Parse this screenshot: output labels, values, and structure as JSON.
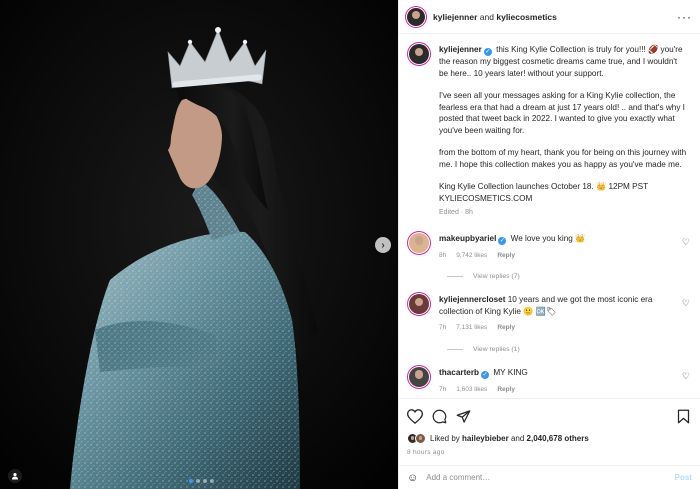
{
  "media": {
    "next_glyph": "›",
    "dots": [
      true,
      false,
      false,
      false
    ],
    "tag_icon": "user-tag-icon"
  },
  "header": {
    "user1": "kyliejenner",
    "and": "and",
    "user2": "kyliecosmetics",
    "more": "···"
  },
  "caption": {
    "username": "kyliejenner",
    "p1": "this King Kylie Collection is truly for you!!! 🏈 you're the reason my biggest cosmetic dreams came true, and I wouldn't be here.. 10 years later! without your support.",
    "p2": "I've seen all your messages asking for a King Kylie collection, the fearless era that had a dream at just 17 years old! .. and that's why I posted that tweet back in 2022. I wanted to give you exactly what you've been waiting for.",
    "p3": "from the bottom of my heart, thank you for being on this journey with me. I hope this collection makes you as happy as you've made me.",
    "p4a": "King Kylie Collection launches October 18. 👑 12PM PST",
    "p4b": "KYLIECOSMETICS.COM",
    "meta": "Edited · 8h"
  },
  "comments": [
    {
      "user": "makeupbyariel",
      "text": "We love you king 👑",
      "time": "8h",
      "likes": "9,742 likes",
      "reply": "Reply",
      "view": "View replies (7)"
    },
    {
      "user": "kyliejennercloset",
      "text": "10 years and we got the most iconic era collection of King Kylie 🙂 🆗🏷",
      "time": "7h",
      "likes": "7,131 likes",
      "reply": "Reply",
      "view": "View replies (1)"
    },
    {
      "user": "thacarterb",
      "text": "MY KING",
      "time": "7h",
      "likes": "1,603 likes",
      "reply": "Reply"
    }
  ],
  "likes": {
    "prefix": "Liked by",
    "user": "haileybieber",
    "and": "and",
    "count": "2,040,678 others"
  },
  "time": "8 hours ago",
  "add_comment": {
    "placeholder": "Add a comment…",
    "post": "Post"
  }
}
